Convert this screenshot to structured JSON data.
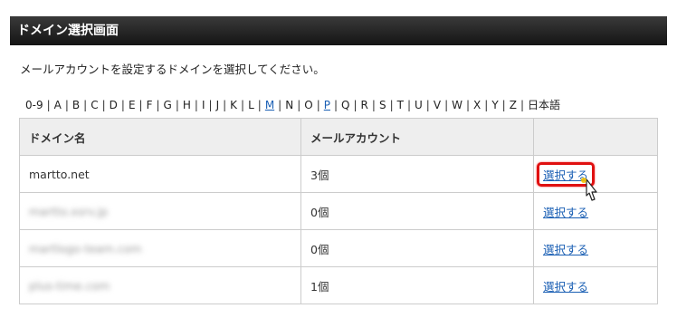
{
  "header": {
    "title": "ドメイン選択画面"
  },
  "instruction": "メールアカウントを設定するドメインを選択してください。",
  "alpha_index": [
    "0-9",
    "A",
    "B",
    "C",
    "D",
    "E",
    "F",
    "G",
    "H",
    "I",
    "J",
    "K",
    "L",
    "M",
    "N",
    "O",
    "P",
    "Q",
    "R",
    "S",
    "T",
    "U",
    "V",
    "W",
    "X",
    "Y",
    "Z",
    "日本語"
  ],
  "alpha_links": [
    "M",
    "P"
  ],
  "table": {
    "headers": [
      "ドメイン名",
      "メールアカウント",
      ""
    ],
    "rows": [
      {
        "domain": "martto.net",
        "count": "3個",
        "action": "選択する",
        "blurred": false,
        "highlighted": true
      },
      {
        "domain": "martto.xsrv.jp",
        "count": "0個",
        "action": "選択する",
        "blurred": true,
        "highlighted": false
      },
      {
        "domain": "martlogo-team.com",
        "count": "0個",
        "action": "選択する",
        "blurred": true,
        "highlighted": false
      },
      {
        "domain": "plus-time.com",
        "count": "1個",
        "action": "選択する",
        "blurred": true,
        "highlighted": false
      }
    ]
  },
  "colors": {
    "accent_link": "#1a5fb4",
    "highlight": "#e01010",
    "header_bg": "#1c1c1c"
  }
}
